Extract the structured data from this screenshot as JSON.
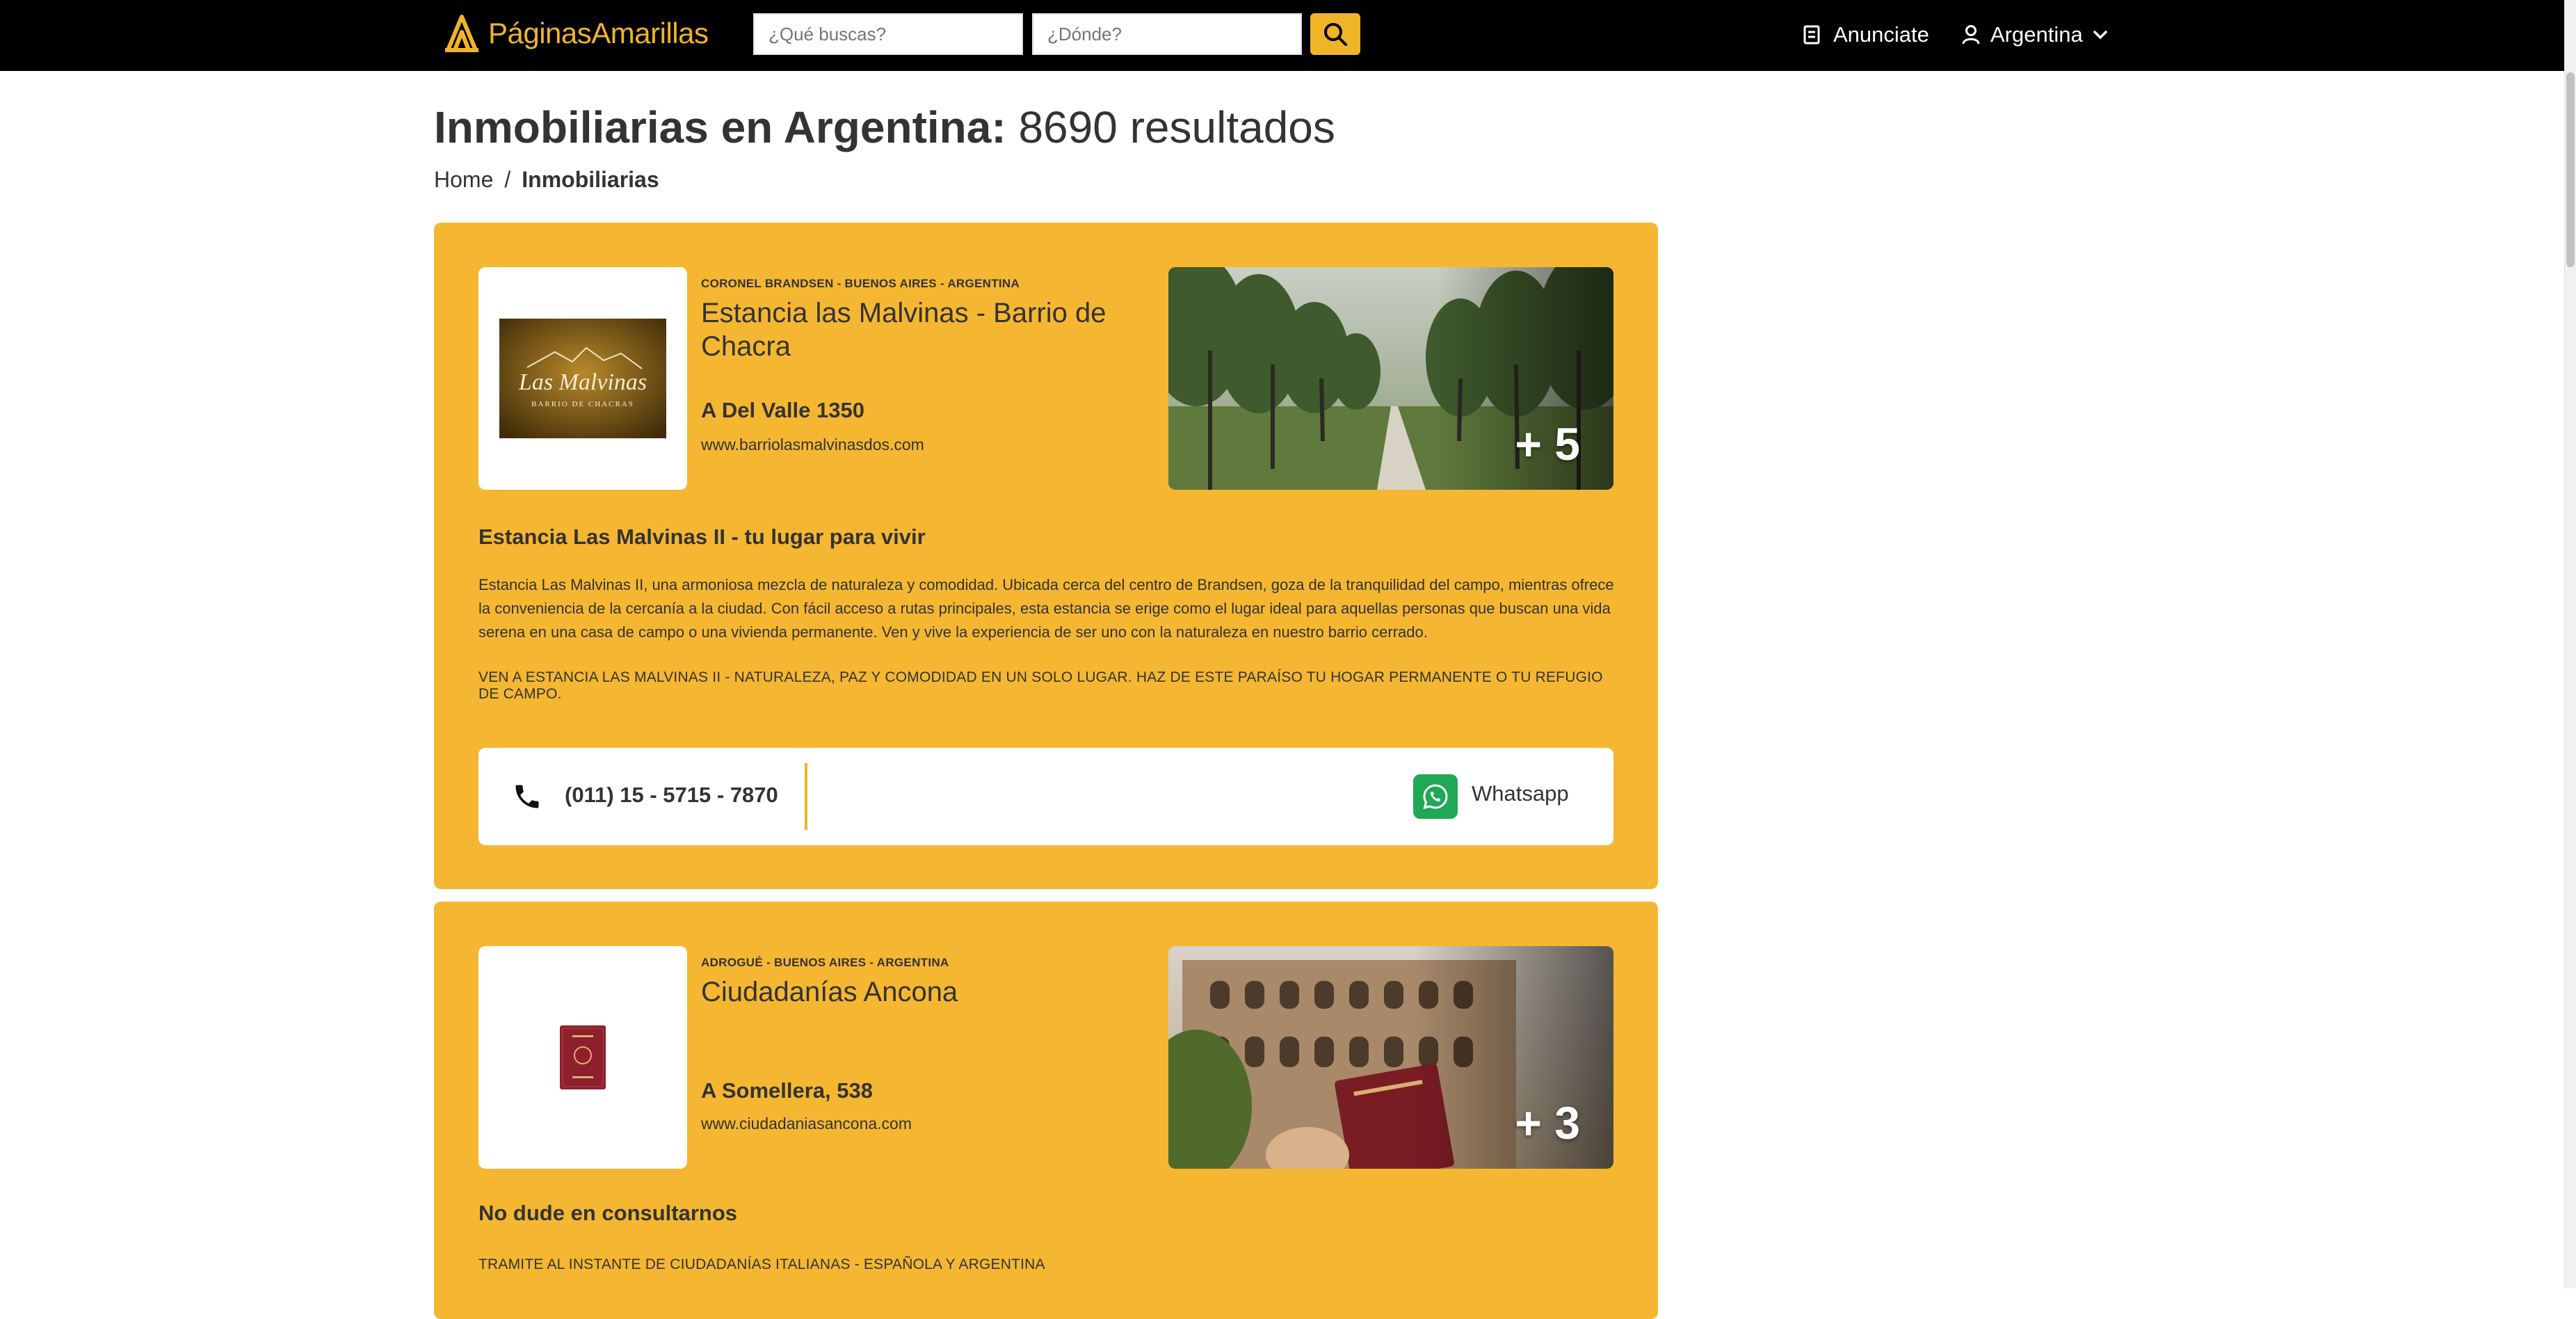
{
  "header": {
    "logo_text_1": "Páginas",
    "logo_text_2": "Amarillas",
    "search_what_placeholder": "¿Qué buscas?",
    "search_where_placeholder": "¿Dónde?",
    "advertise_label": "Anunciate",
    "country_label": "Argentina"
  },
  "page": {
    "title_strong": "Inmobiliarias en Argentina:",
    "title_count": "8690 resultados"
  },
  "breadcrumb": {
    "home": "Home",
    "separator": "/",
    "current": "Inmobiliarias"
  },
  "listings": [
    {
      "location": "CORONEL BRANDSEN - BUENOS AIRES - ARGENTINA",
      "name": "Estancia las Malvinas - Barrio de Chacra",
      "address": "A Del Valle 1350",
      "website": "www.barriolasmalvinasdos.com",
      "logo_text": "Las Malvinas",
      "logo_sub": "BARRIO DE CHACRAS",
      "photo_count": "+ 5",
      "tagline": "Estancia Las Malvinas II - tu lugar para vivir",
      "description": "Estancia Las Malvinas II, una armoniosa mezcla de naturaleza y comodidad. Ubicada cerca del centro de Brandsen, goza de la tranquilidad del campo, mientras ofrece la conveniencia de la cercanía a la ciudad. Con fácil acceso a rutas principales, esta estancia se erige como el lugar ideal para aquellas personas que buscan una vida serena en una casa de campo o una vivienda permanente. Ven y vive la experiencia de ser uno con la naturaleza en nuestro barrio cerrado.",
      "promo": "VEN A ESTANCIA LAS MALVINAS II - NATURALEZA, PAZ Y COMODIDAD EN UN SOLO LUGAR. HAZ DE ESTE PARAÍSO TU HOGAR PERMANENTE O TU REFUGIO DE CAMPO.",
      "phone": "(011) 15 - 5715 - 7870",
      "whatsapp_label": "Whatsapp"
    },
    {
      "location": "ADROGUÉ - BUENOS AIRES - ARGENTINA",
      "name": "Ciudadanías Ancona",
      "address": "A Somellera, 538",
      "website": "www.ciudadaniasancona.com",
      "photo_count": "+ 3",
      "tagline": "No dude en consultarnos",
      "promo": "TRAMITE AL INSTANTE DE CIUDADANÍAS ITALIANAS - ESPAÑOLA Y ARGENTINA"
    }
  ],
  "colors": {
    "brand_yellow": "#f0b429",
    "card_yellow": "#f5b731",
    "header_black": "#000000",
    "whatsapp_green": "#1fa855"
  },
  "icons": [
    "logo-mark-icon",
    "search-icon",
    "megaphone-icon",
    "user-icon",
    "chevron-down-icon",
    "phone-icon",
    "whatsapp-icon"
  ]
}
